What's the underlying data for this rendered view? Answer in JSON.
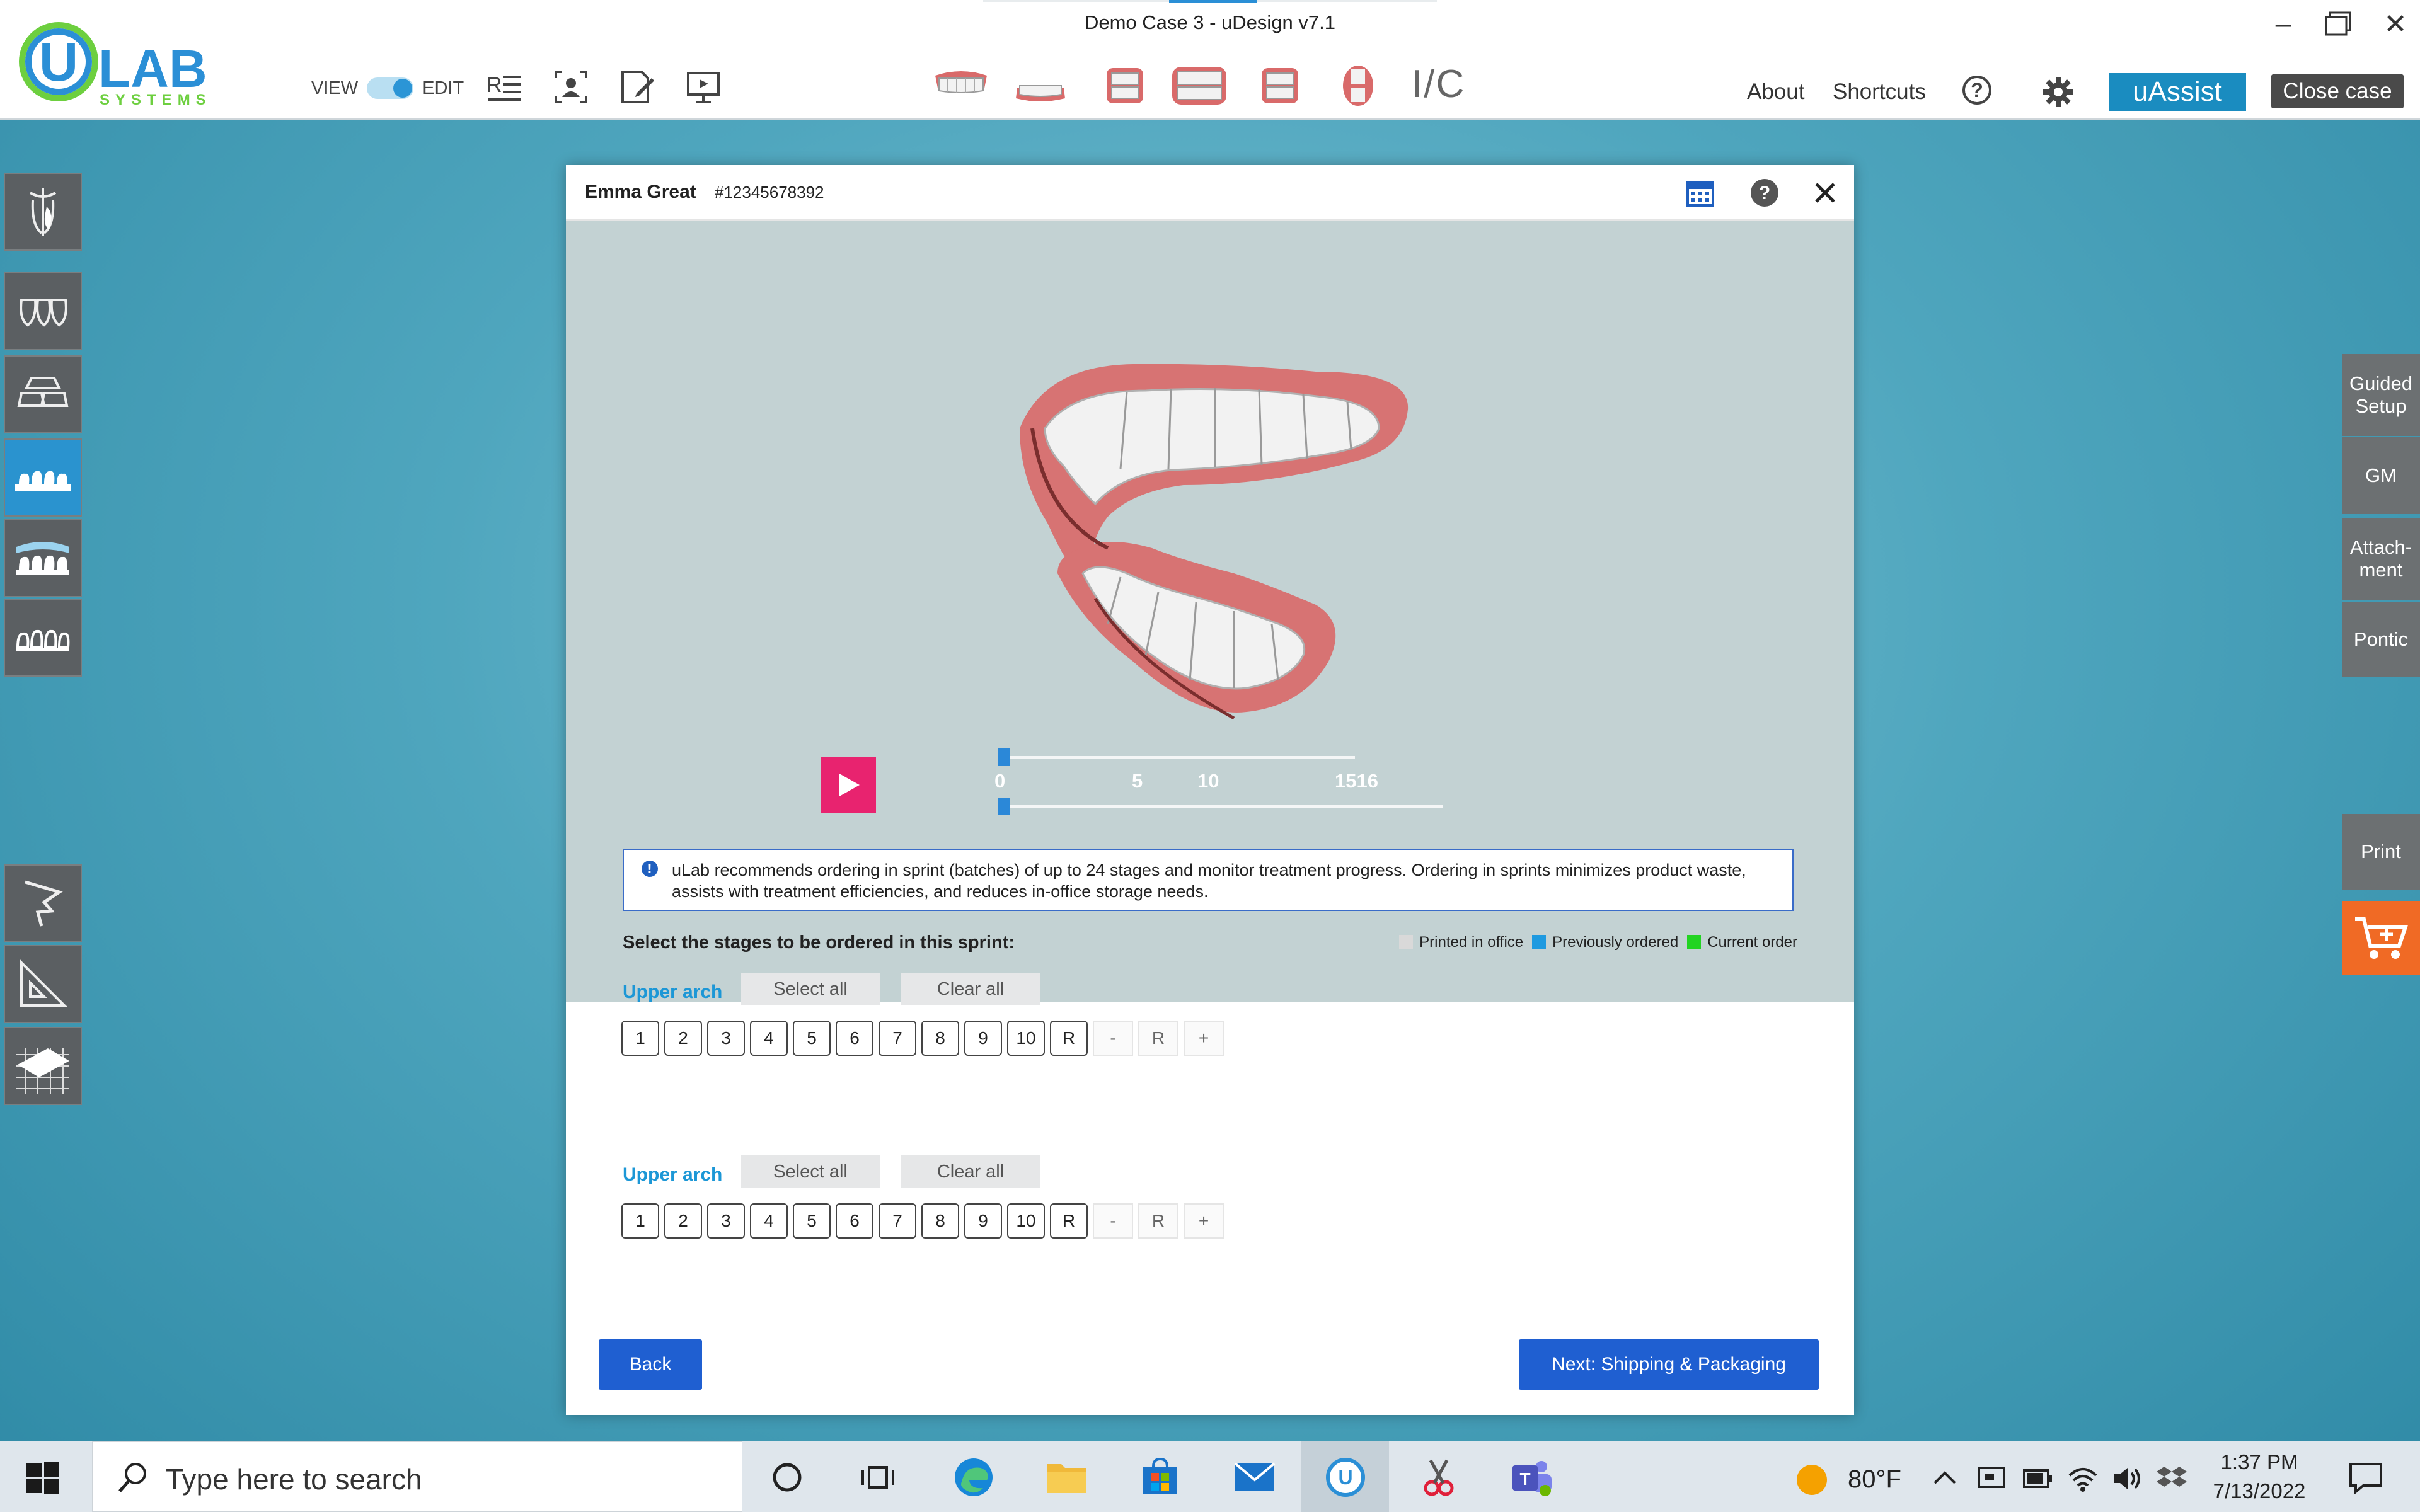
{
  "window": {
    "title": "Demo Case 3 - uDesign v7.1"
  },
  "logo": {
    "text_main": "LAB",
    "text_sub": "SYSTEMS",
    "initial": "U"
  },
  "toolbar": {
    "view_label": "VIEW",
    "edit_label": "EDIT",
    "ic_label": "I/C",
    "about_label": "About",
    "shortcuts_label": "Shortcuts",
    "help_label": "?",
    "uassist_label": "uAssist",
    "close_case_label": "Close case",
    "mode_toggle_state": "edit"
  },
  "right_panel": {
    "guided_setup": "Guided Setup",
    "gm": "GM",
    "attachment": "Attach- ment",
    "pontic": "Pontic",
    "print": "Print"
  },
  "dialog": {
    "patient_name": "Emma Great",
    "patient_id": "#12345678392",
    "slider": {
      "ticks": [
        "0",
        "5",
        "10",
        "1516"
      ],
      "current_stage": 0
    },
    "info_text": "uLab recommends ordering in sprint (batches) of up to 24 stages and monitor treatment progress.  Ordering in sprints minimizes product waste, assists with treatment efficiencies, and reduces in-office storage needs.",
    "select_heading": "Select the stages to be ordered in this sprint:",
    "legend": [
      {
        "label": "Printed in office",
        "color": "#d9d9d9"
      },
      {
        "label": "Previously ordered",
        "color": "#1e9ae0"
      },
      {
        "label": "Current order",
        "color": "#22d422"
      }
    ],
    "arches": [
      {
        "label": "Upper arch",
        "select_all": "Select all",
        "clear_all": "Clear all",
        "stages": [
          "1",
          "2",
          "3",
          "4",
          "5",
          "6",
          "7",
          "8",
          "9",
          "10",
          "R"
        ],
        "extra": [
          "-",
          "R",
          "+"
        ]
      },
      {
        "label": "Upper arch",
        "select_all": "Select all",
        "clear_all": "Clear all",
        "stages": [
          "1",
          "2",
          "3",
          "4",
          "5",
          "6",
          "7",
          "8",
          "9",
          "10",
          "R"
        ],
        "extra": [
          "-",
          "R",
          "+"
        ]
      }
    ],
    "back_label": "Back",
    "next_label": "Next: Shipping & Packaging"
  },
  "taskbar": {
    "search_placeholder": "Type here to search",
    "weather": "80°F",
    "time": "1:37 PM",
    "date": "7/13/2022"
  }
}
